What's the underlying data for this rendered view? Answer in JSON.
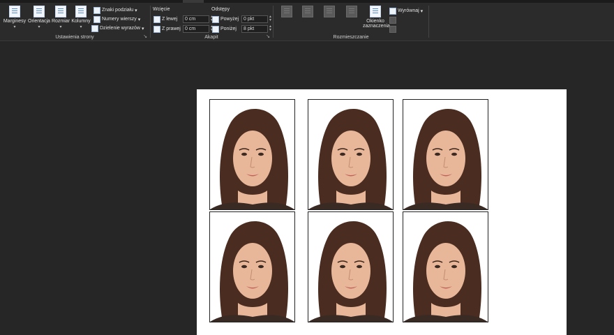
{
  "ribbon": {
    "page_setup": {
      "label": "Ustawienia strony",
      "margins": "Marginesy",
      "orientation": "Orientacja",
      "size": "Rozmiar",
      "columns": "Kolumny",
      "breaks": "Znaki podziału",
      "line_numbers": "Numery wierszy",
      "hyphenation": "Dzielenie wyrazów"
    },
    "paragraph": {
      "label": "Akapit",
      "indent_heading": "Wcięcie",
      "spacing_heading": "Odstępy",
      "indent_left_label": "Z lewej",
      "indent_left_value": "0 cm",
      "indent_right_label": "Z prawej",
      "indent_right_value": "0 cm",
      "spacing_before_label": "Powyżej",
      "spacing_before_value": "0 pkt",
      "spacing_after_label": "Poniżej",
      "spacing_after_value": "8 pkt"
    },
    "arrange": {
      "label": "Rozmieszczanie",
      "selection_pane_line1": "Okienko",
      "selection_pane_line2": "zaznaczenia",
      "align": "Wyrównaj"
    }
  },
  "document": {
    "photo_count": 6,
    "colors": {
      "background": "#262626",
      "page": "#ffffff",
      "hair": "#4a2c20",
      "skin": "#e8b79a"
    }
  }
}
